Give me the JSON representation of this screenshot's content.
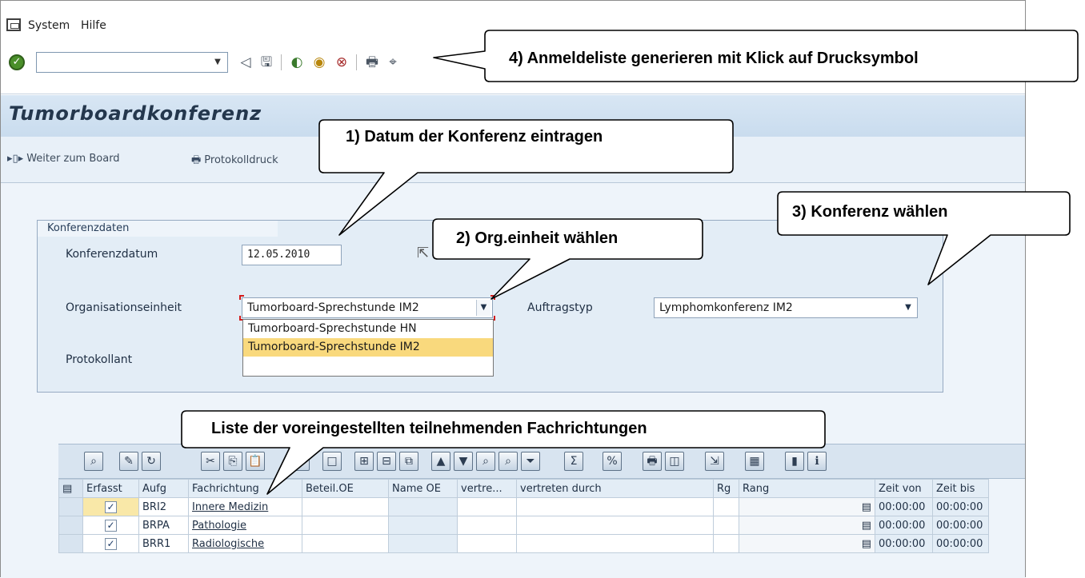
{
  "menu": {
    "items": [
      "System",
      "Hilfe"
    ]
  },
  "toolbar": {
    "command_value": ""
  },
  "header": {
    "title": "Tumorboardkonferenz"
  },
  "appbar": {
    "weiter_label": "Weiter zum Board",
    "protokoll_label": "Protokolldruck"
  },
  "group": {
    "title": "Konferenzdaten",
    "datum_label": "Konferenzdatum",
    "datum_value": "12.05.2010",
    "oe_label": "Organisationseinheit",
    "oe_value": "Tumorboard-Sprechstunde IM2",
    "oe_options": [
      "Tumorboard-Sprechstunde HN",
      "Tumorboard-Sprechstunde IM2"
    ],
    "auftrag_label": "Auftragstyp",
    "auftrag_value": "Lymphomkonferenz IM2",
    "protokollant_label": "Protokollant"
  },
  "table": {
    "headers": [
      "Erfasst",
      "Aufg",
      "Fachrichtung",
      "Beteil.OE",
      "Name OE",
      "vertre...",
      "vertreten durch",
      "Rg",
      "Rang",
      "Zeit von",
      "Zeit bis"
    ],
    "rows": [
      {
        "aufg": "BRI2",
        "fach": "Innere Medizin",
        "von": "00:00:00",
        "bis": "00:00:00"
      },
      {
        "aufg": "BRPA",
        "fach": "Pathologie",
        "von": "00:00:00",
        "bis": "00:00:00"
      },
      {
        "aufg": "BRR1",
        "fach": "Radiologische",
        "von": "00:00:00",
        "bis": "00:00:00"
      }
    ]
  },
  "callouts": {
    "c1": "1) Datum der Konferenz eintragen",
    "c2": "2) Org.einheit wählen",
    "c3": "3) Konferenz wählen",
    "c4": "4) Anmeldeliste generieren mit Klick auf Drucksymbol",
    "c5": "Liste der voreingestellten teilnehmenden Fachrichtungen"
  }
}
